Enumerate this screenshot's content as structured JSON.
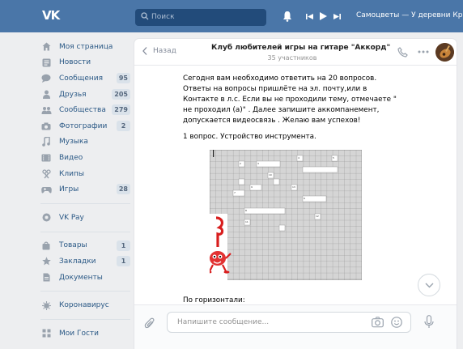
{
  "topbar": {
    "logo": "VK",
    "search_placeholder": "Поиск",
    "now_playing": "Самоцветы — У деревни Крюково"
  },
  "sidebar": {
    "items": [
      {
        "label": "Моя страница",
        "icon": "home-icon"
      },
      {
        "label": "Новости",
        "icon": "news-icon"
      },
      {
        "label": "Сообщения",
        "icon": "messages-icon",
        "count": "95"
      },
      {
        "label": "Друзья",
        "icon": "friends-icon",
        "count": "205"
      },
      {
        "label": "Сообщества",
        "icon": "groups-icon",
        "count": "279"
      },
      {
        "label": "Фотографии",
        "icon": "camera-icon",
        "count": "2"
      },
      {
        "label": "Музыка",
        "icon": "music-icon"
      },
      {
        "label": "Видео",
        "icon": "video-icon"
      },
      {
        "label": "Клипы",
        "icon": "clips-icon"
      },
      {
        "label": "Игры",
        "icon": "games-icon",
        "count": "28"
      }
    ],
    "vkpay": "VK Pay",
    "items2": [
      {
        "label": "Товары",
        "icon": "goods-icon",
        "count": "1"
      },
      {
        "label": "Закладки",
        "icon": "star-icon",
        "count": "1"
      },
      {
        "label": "Документы",
        "icon": "docs-icon"
      }
    ],
    "corona": "Коронавирус",
    "guests": "Мои Гости"
  },
  "chat": {
    "back": "Назад",
    "title": "Клуб любителей игры на гитаре \"Аккорд\"",
    "subtitle": "35 участников",
    "message": "Сегодня вам необходимо ответить на 20 вопросов. Ответы на вопросы пришлёте на эл. почту,или в Контакте в л.с. Если вы не проходили тему, отмечаете \" не проходил (а)\" . Далее запишите аккомпанемент, допускается видеосвязь . Желаю вам успехов!",
    "question1": "1 вопрос. Устройство инструмента.",
    "horizontal": "По горизонтали:",
    "input_placeholder": "Напишите сообщение..."
  },
  "colors": {
    "header": "#4a76a8",
    "link": "#2a5885",
    "background": "#edeef0"
  }
}
